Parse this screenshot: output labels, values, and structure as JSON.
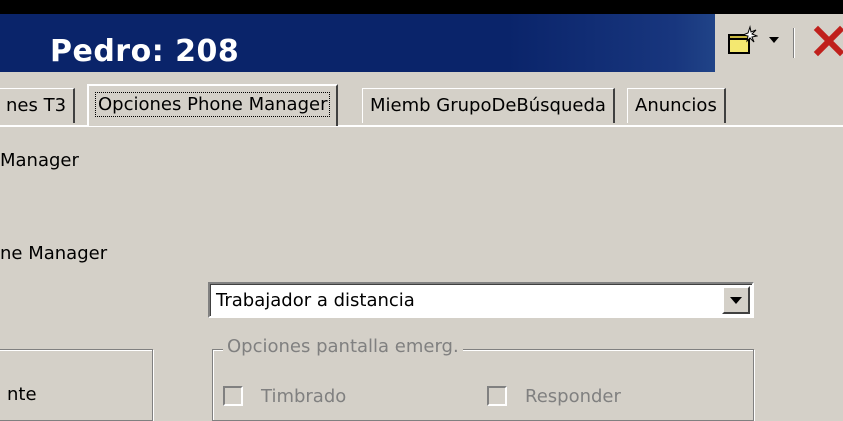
{
  "window": {
    "title": "Pedro: 208"
  },
  "tabs": [
    {
      "label": "nes T3",
      "active": false
    },
    {
      "label": "Opciones Phone Manager",
      "active": true
    },
    {
      "label": "Miemb GrupoDeBúsqueda",
      "active": false
    },
    {
      "label": "Anuncios",
      "active": false
    }
  ],
  "panel": {
    "label_manager": "Manager",
    "label_phone_manager": "ne Manager",
    "left_box_text": "nte",
    "dropdown_value": "Trabajador a distancia",
    "popup_group_title": "Opciones pantalla emerg.",
    "checkbox_ring": "Timbrado",
    "checkbox_answer": "Responder"
  },
  "icons": {
    "new": "new-item-icon",
    "dropdown_arrow": "chevron-down-icon",
    "close": "close-icon"
  }
}
